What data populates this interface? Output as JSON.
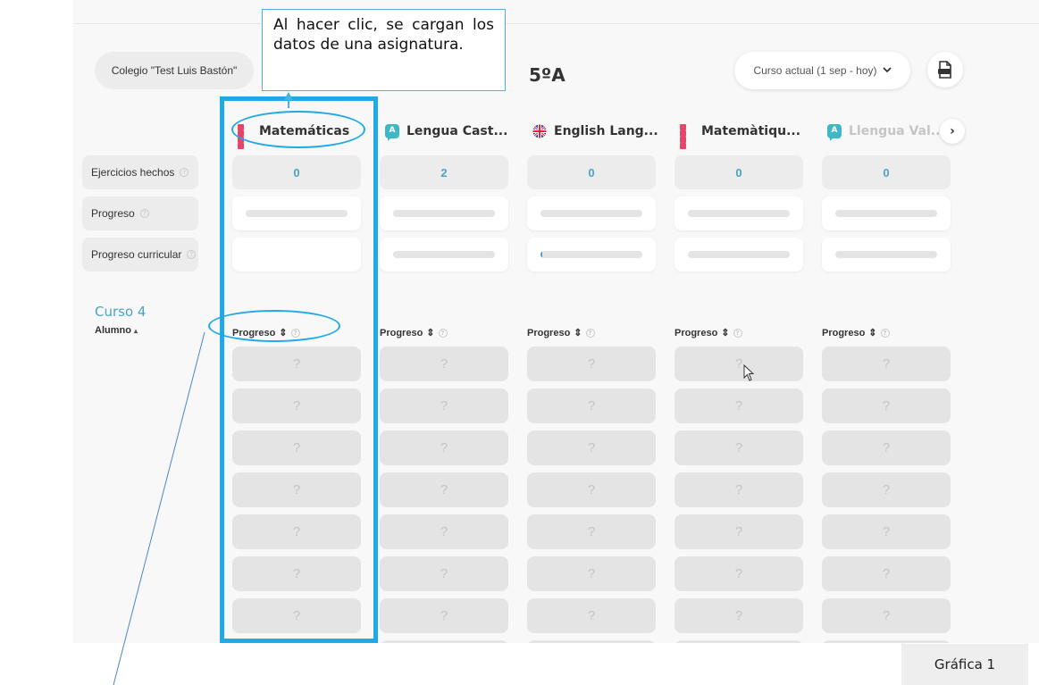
{
  "header": {
    "school_label": "Colegio \"Test Luis Bastón\"",
    "class_title": "5ºA",
    "period_label": "Curso actual (1 sep - hoy)",
    "period_chevron_icon": "chevron-down-icon",
    "pdf_icon": "pdf-icon"
  },
  "subjects": [
    {
      "label": "Matemáticas",
      "icon": "grid-icon",
      "exercises": "0",
      "progress": 0,
      "curricular_progress": null
    },
    {
      "label": "Lengua Cast...",
      "icon": "speech-bubble-icon",
      "exercises": "2",
      "progress": 0,
      "curricular_progress": 0
    },
    {
      "label": "English Lang...",
      "icon": "uk-flag-icon",
      "exercises": "0",
      "progress": 0,
      "curricular_progress": 0.02
    },
    {
      "label": "Matemàtiqu...",
      "icon": "grid-icon",
      "exercises": "0",
      "progress": 0,
      "curricular_progress": 0
    },
    {
      "label": "Llengua Val...",
      "icon": "speech-bubble-icon",
      "exercises": "0",
      "progress": 0,
      "curricular_progress": 0
    }
  ],
  "next_icon": "chevron-right-icon",
  "rows": {
    "exercises_label": "Ejercicios hechos",
    "progress_label": "Progreso",
    "curricular_label": "Progreso curricular"
  },
  "course": {
    "title": "Curso 4",
    "student_header": "Alumno",
    "student_sort": "▴",
    "column_header": "Progreso",
    "column_sort": "⇕",
    "placeholder": "?"
  },
  "colors": {
    "accent": "#4aa3c4",
    "annotation": "#1fa9e6",
    "math_icon": "#e4456b",
    "language_icon": "#3fb8c6"
  },
  "annotation": {
    "callout_text": "Al hacer clic, se cargan los datos de una asignatura.",
    "figure_label": "Gráfica 1"
  }
}
